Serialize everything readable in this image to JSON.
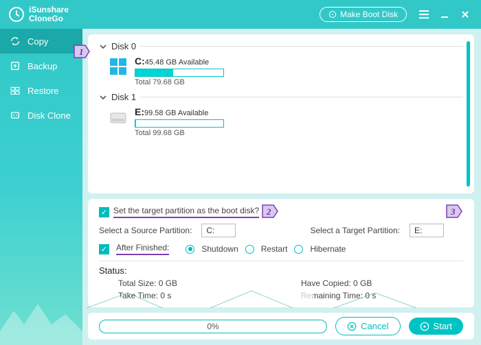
{
  "app": {
    "name_line1": "iSunshare",
    "name_line2": "CloneGo",
    "make_boot": "Make Boot Disk"
  },
  "sidebar": {
    "items": [
      {
        "label": "Copy",
        "active": true
      },
      {
        "label": "Backup",
        "active": false
      },
      {
        "label": "Restore",
        "active": false
      },
      {
        "label": "Disk Clone",
        "active": false
      }
    ]
  },
  "disks": [
    {
      "name": "Disk 0",
      "letter": "C:",
      "available": "45.48 GB Available",
      "total": "Total 79.68 GB",
      "fill_pct": 43,
      "icon": "windows"
    },
    {
      "name": "Disk 1",
      "letter": "E:",
      "available": "99.58 GB Available",
      "total": "Total 99.68 GB",
      "fill_pct": 1,
      "icon": "drive"
    }
  ],
  "settings": {
    "boot_question": "Set the target partition as the boot disk?",
    "source_label": "Select a Source Partition:",
    "source_value": "C:",
    "target_label": "Select a Target Partition:",
    "target_value": "E:",
    "after_label": "After Finished:",
    "radios": {
      "shutdown": "Shutdown",
      "restart": "Restart",
      "hibernate": "Hibernate"
    },
    "selected_radio": "shutdown"
  },
  "status": {
    "title": "Status:",
    "total_size": "Total Size: 0 GB",
    "have_copied": "Have Copied: 0 GB",
    "take_time": "Take Time: 0 s",
    "remaining": "Remaining Time: 0 s"
  },
  "footer": {
    "progress": "0%",
    "cancel": "Cancel",
    "start": "Start"
  },
  "annotations": {
    "tag1": "1",
    "tag2": "2",
    "tag3": "3"
  },
  "colors": {
    "accent": "#00c3c3",
    "annotation": "#7a3fb5"
  }
}
